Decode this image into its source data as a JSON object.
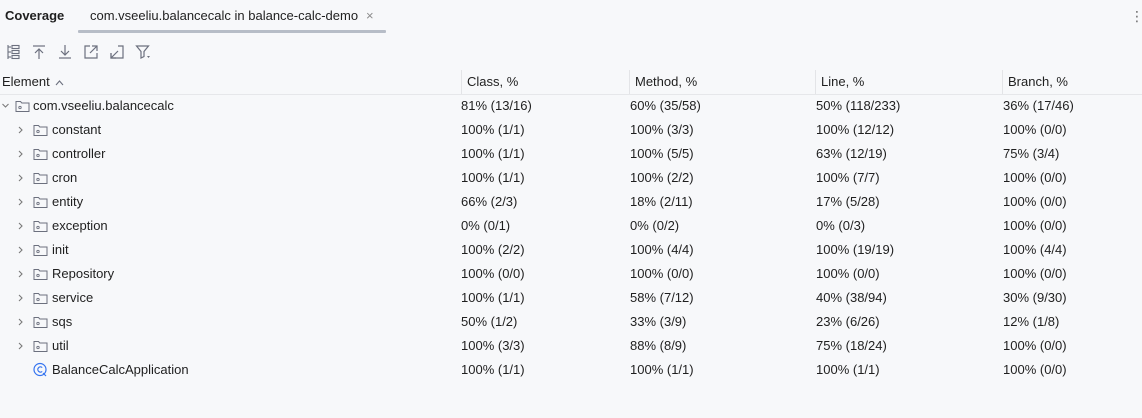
{
  "tool_window": {
    "title": "Coverage",
    "tab_label": "com.vseeliu.balancecalc in balance-calc-demo",
    "close_glyph": "×",
    "more_glyph": "⋮"
  },
  "toolbar": {
    "icons": [
      "flatten-packages-icon",
      "go-to-top-icon",
      "go-to-bottom-icon",
      "export-icon",
      "import-icon",
      "filter-icon"
    ]
  },
  "table": {
    "headers": {
      "element": "Element",
      "sort_arrow": "^",
      "class": "Class, %",
      "method": "Method, %",
      "line": "Line, %",
      "branch": "Branch, %"
    },
    "root": {
      "name": "com.vseeliu.balancecalc",
      "chevron": "⌄",
      "class": "81% (13/16)",
      "method": "60% (35/58)",
      "line": "50% (118/233)",
      "branch": "36% (17/46)"
    },
    "rows": [
      {
        "name": "constant",
        "type": "package",
        "class": "100% (1/1)",
        "method": "100% (3/3)",
        "line": "100% (12/12)",
        "branch": "100% (0/0)"
      },
      {
        "name": "controller",
        "type": "package",
        "class": "100% (1/1)",
        "method": "100% (5/5)",
        "line": "63% (12/19)",
        "branch": "75% (3/4)"
      },
      {
        "name": "cron",
        "type": "package",
        "class": "100% (1/1)",
        "method": "100% (2/2)",
        "line": "100% (7/7)",
        "branch": "100% (0/0)"
      },
      {
        "name": "entity",
        "type": "package",
        "class": "66% (2/3)",
        "method": "18% (2/11)",
        "line": "17% (5/28)",
        "branch": "100% (0/0)"
      },
      {
        "name": "exception",
        "type": "package",
        "class": "0% (0/1)",
        "method": "0% (0/2)",
        "line": "0% (0/3)",
        "branch": "100% (0/0)"
      },
      {
        "name": "init",
        "type": "package",
        "class": "100% (2/2)",
        "method": "100% (4/4)",
        "line": "100% (19/19)",
        "branch": "100% (4/4)"
      },
      {
        "name": "Repository",
        "type": "package",
        "class": "100% (0/0)",
        "method": "100% (0/0)",
        "line": "100% (0/0)",
        "branch": "100% (0/0)"
      },
      {
        "name": "service",
        "type": "package",
        "class": "100% (1/1)",
        "method": "58% (7/12)",
        "line": "40% (38/94)",
        "branch": "30% (9/30)"
      },
      {
        "name": "sqs",
        "type": "package",
        "class": "50% (1/2)",
        "method": "33% (3/9)",
        "line": "23% (6/26)",
        "branch": "12% (1/8)"
      },
      {
        "name": "util",
        "type": "package",
        "class": "100% (3/3)",
        "method": "88% (8/9)",
        "line": "75% (18/24)",
        "branch": "100% (0/0)"
      },
      {
        "name": "BalanceCalcApplication",
        "type": "class",
        "class": "100% (1/1)",
        "method": "100% (1/1)",
        "line": "100% (1/1)",
        "branch": "100% (0/0)"
      }
    ],
    "row_chevron": "›"
  },
  "colors": {
    "background": "#f7f8fa",
    "tab_underline": "#b7bdc7",
    "class_icon": "#3574f0"
  }
}
